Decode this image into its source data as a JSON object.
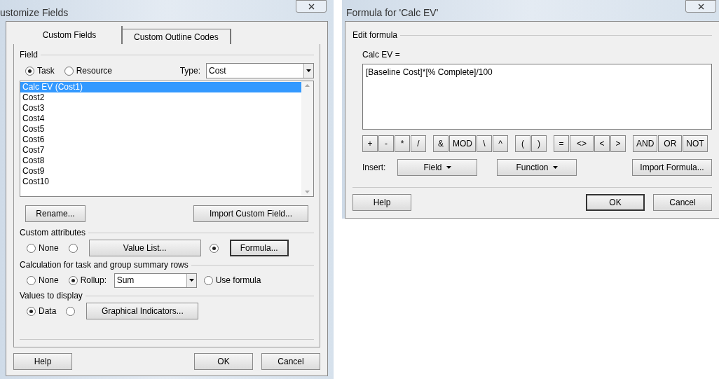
{
  "customize_fields": {
    "title": "ustomize Fields",
    "tabs": [
      {
        "label": "Custom Fields",
        "selected": true
      },
      {
        "label": "Custom Outline Codes",
        "selected": false
      }
    ],
    "field_group": {
      "label": "Field",
      "entity_options": [
        {
          "label": "Task",
          "selected": true
        },
        {
          "label": "Resource",
          "selected": false
        }
      ],
      "type_label": "Type:",
      "type_value": "Cost",
      "fields": [
        {
          "label": "Calc EV (Cost1)",
          "selected": true
        },
        {
          "label": "Cost2",
          "selected": false
        },
        {
          "label": "Cost3",
          "selected": false
        },
        {
          "label": "Cost4",
          "selected": false
        },
        {
          "label": "Cost5",
          "selected": false
        },
        {
          "label": "Cost6",
          "selected": false
        },
        {
          "label": "Cost7",
          "selected": false
        },
        {
          "label": "Cost8",
          "selected": false
        },
        {
          "label": "Cost9",
          "selected": false
        },
        {
          "label": "Cost10",
          "selected": false
        }
      ]
    },
    "rename_button": "Rename...",
    "import_button": "Import Custom Field...",
    "custom_attributes": {
      "label": "Custom attributes",
      "options": [
        {
          "kind": "plain",
          "label": "None",
          "selected": false
        },
        {
          "kind": "button",
          "label": "Value List...",
          "selected": false
        },
        {
          "kind": "button",
          "label": "Formula...",
          "selected": true
        }
      ]
    },
    "calculation": {
      "label": "Calculation for task and group summary rows",
      "options": [
        {
          "kind": "plain",
          "label": "None",
          "selected": false
        },
        {
          "kind": "dropdown",
          "label": "Rollup:",
          "value": "Sum",
          "selected": true
        },
        {
          "kind": "plain",
          "label": "Use formula",
          "selected": false
        }
      ]
    },
    "values_to_display": {
      "label": "Values to display",
      "options": [
        {
          "kind": "plain",
          "label": "Data",
          "selected": true
        },
        {
          "kind": "button",
          "label": "Graphical Indicators...",
          "selected": false
        }
      ]
    },
    "buttons": [
      {
        "label": "Help",
        "default": false
      },
      {
        "label": "OK",
        "default": false
      },
      {
        "label": "Cancel",
        "default": false
      }
    ]
  },
  "formula_dialog": {
    "title": "Formula for 'Calc EV'",
    "group_label": "Edit formula",
    "field_label": "Calc EV =",
    "formula": "[Baseline Cost]*[% Complete]/100",
    "operator_groups": [
      [
        "+",
        "-",
        "*",
        "/"
      ],
      [
        "&",
        "MOD",
        "\\",
        "^"
      ],
      [
        "(",
        ")"
      ],
      [
        "=",
        "<>",
        "<",
        ">"
      ],
      [
        "AND",
        "OR",
        "NOT"
      ]
    ],
    "insert_label": "Insert:",
    "insert_buttons": [
      {
        "label": "Field",
        "dropdown": true
      },
      {
        "label": "Function",
        "dropdown": true
      },
      {
        "label": "Import Formula...",
        "dropdown": false
      }
    ],
    "buttons": [
      {
        "label": "Help",
        "default": false
      },
      {
        "label": "OK",
        "default": true
      },
      {
        "label": "Cancel",
        "default": false
      }
    ]
  }
}
